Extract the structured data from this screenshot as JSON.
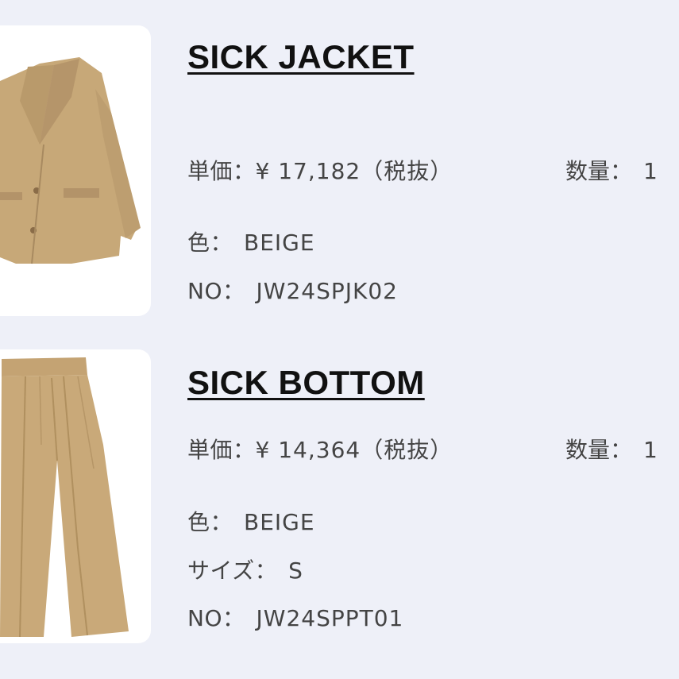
{
  "items": [
    {
      "name": "SICK JACKET",
      "unit_price_label": "単価：",
      "unit_price": "¥ 17,182（税抜）",
      "qty_label": "数量：",
      "qty": "1",
      "color_label": "色：",
      "color": "BEIGE",
      "no_label": "NO：",
      "no": "JW24SPJK02",
      "image_icon": "jacket-icon",
      "image_color": "#c9a979"
    },
    {
      "name": "SICK BOTTOM",
      "unit_price_label": "単価：",
      "unit_price": "¥ 14,364（税抜）",
      "qty_label": "数量：",
      "qty": "1",
      "color_label": "色：",
      "color": "BEIGE",
      "size_label": "サイズ：",
      "size": "S",
      "no_label": "NO：",
      "no": "JW24SPPT01",
      "image_icon": "trousers-icon",
      "image_color": "#c9a979"
    }
  ]
}
